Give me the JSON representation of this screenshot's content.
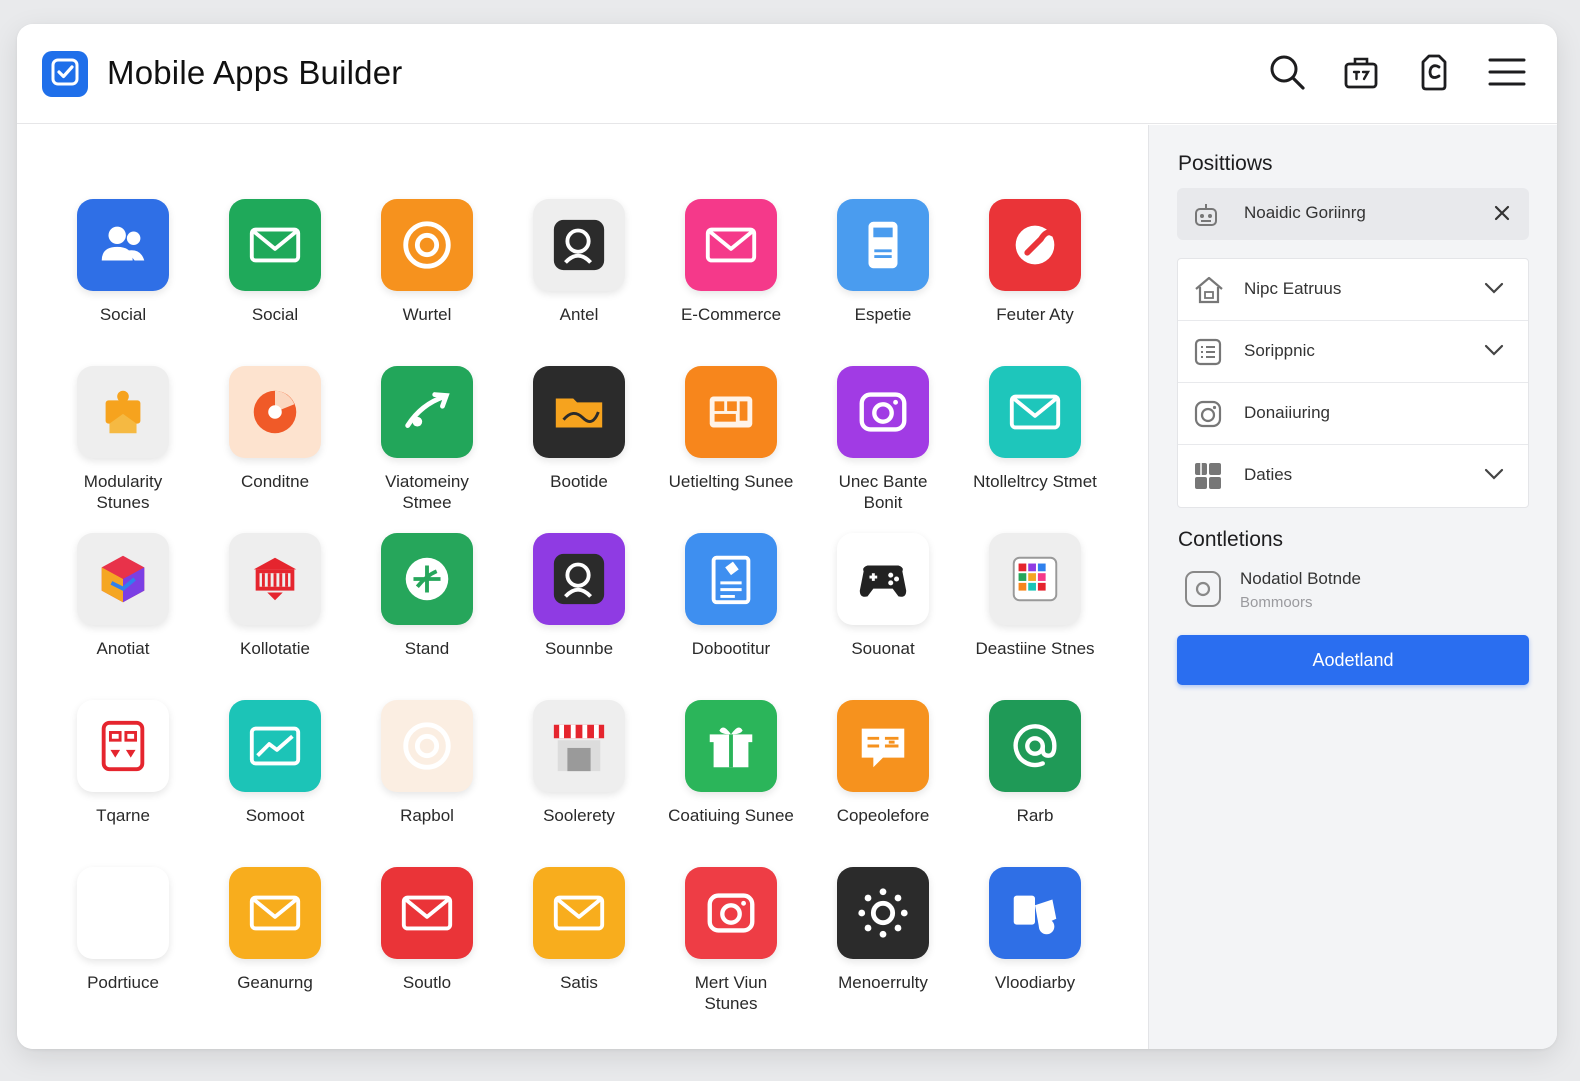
{
  "header": {
    "title": "Mobile Apps Builder",
    "logo_color": "#1f6fea",
    "actions": [
      "search-icon",
      "briefcase-icon",
      "tag-icon",
      "menu-icon"
    ]
  },
  "apps": [
    {
      "label": "Social",
      "bg": "#2f6fe6",
      "icon": "users-icon"
    },
    {
      "label": "Social",
      "bg": "#1fa95a",
      "icon": "mail-icon"
    },
    {
      "label": "Wurtel",
      "bg": "#f6921e",
      "icon": "target-icon"
    },
    {
      "label": "Antel",
      "bg": "#eeeeee",
      "icon": "search-icon"
    },
    {
      "label": "E-Commerce",
      "bg": "#f5398a",
      "icon": "mail-icon"
    },
    {
      "label": "Espetie",
      "bg": "#4a9cef",
      "icon": "phone-icon"
    },
    {
      "label": "Feuter Aty",
      "bg": "#ea3438",
      "icon": "wrench-icon"
    },
    {
      "label": "Modularity Stunes",
      "bg": "#eeeeee",
      "icon": "puzzle-icon"
    },
    {
      "label": "Conditne",
      "bg": "#fde3cf",
      "icon": "pie-icon"
    },
    {
      "label": "Viatomeiny Stmee",
      "bg": "#22a65a",
      "icon": "arrow-icon"
    },
    {
      "label": "Bootide",
      "bg": "#2b2b2b",
      "icon": "folder-icon"
    },
    {
      "label": "Uetielting Sunee",
      "bg": "#f7861c",
      "icon": "grid-icon"
    },
    {
      "label": "Unec Bante Bonit",
      "bg": "#a13be4",
      "icon": "camera-icon"
    },
    {
      "label": "Ntolleltrcy Stmet",
      "bg": "#1ec6bb",
      "icon": "mail-icon"
    },
    {
      "label": "Anotiat",
      "bg": "#eeeeee",
      "icon": "cube-icon"
    },
    {
      "label": "Kollotatie",
      "bg": "#eeeeee",
      "icon": "store-icon"
    },
    {
      "label": "Stand",
      "bg": "#26a65b",
      "icon": "leaf-icon"
    },
    {
      "label": "Sounnbe",
      "bg": "#8f3be3",
      "icon": "search-icon"
    },
    {
      "label": "Dobootitur",
      "bg": "#3e8ff0",
      "icon": "document-icon"
    },
    {
      "label": "Souonat",
      "bg": "#ffffff",
      "icon": "gamepad-icon"
    },
    {
      "label": "Deastiine Stnes",
      "bg": "#eeeeee",
      "icon": "palette-icon"
    },
    {
      "label": "Tqarne",
      "bg": "#ffffff",
      "icon": "calculator-icon"
    },
    {
      "label": "Somoot",
      "bg": "#1cc4b7",
      "icon": "chart-icon"
    },
    {
      "label": "Rapbol",
      "bg": "#fbeee2",
      "icon": "target-icon"
    },
    {
      "label": "Soolerety",
      "bg": "#eeeeee",
      "icon": "storefront-icon"
    },
    {
      "label": "Coatiuing Sunee",
      "bg": "#2bb55a",
      "icon": "gift-icon"
    },
    {
      "label": "Copeolefore",
      "bg": "#f6921e",
      "icon": "chat-icon"
    },
    {
      "label": "Rarb",
      "bg": "#1f9a57",
      "icon": "at-icon"
    },
    {
      "label": "Podrtiuce",
      "bg": "#ffffff",
      "icon": "mail-icon"
    },
    {
      "label": "Geanurng",
      "bg": "#f8ad1d",
      "icon": "mail-icon"
    },
    {
      "label": "Soutlo",
      "bg": "#ea3438",
      "icon": "mail-icon"
    },
    {
      "label": "Satis",
      "bg": "#f8ad1d",
      "icon": "mail-icon"
    },
    {
      "label": "Mert Viun Stunes",
      "bg": "#ee3d45",
      "icon": "camera-icon"
    },
    {
      "label": "Menoerrulty",
      "bg": "#2b2b2b",
      "icon": "gear-icon"
    },
    {
      "label": "Vloodiarby",
      "bg": "#2f6fe6",
      "icon": "shapes-icon"
    }
  ],
  "sidebar": {
    "positions_title": "Posittiows",
    "chip": {
      "label": "Noaidic Goriinrg",
      "icon": "robot-icon"
    },
    "list": [
      {
        "label": "Nipc Eatruus",
        "icon": "home-icon",
        "chevron": true
      },
      {
        "label": "Sorippnic",
        "icon": "list-icon",
        "chevron": true
      },
      {
        "label": "Donaiiuring",
        "icon": "camera-icon",
        "chevron": false
      },
      {
        "label": "Daties",
        "icon": "grid-icon",
        "chevron": true
      }
    ],
    "connections_title": "Contletions",
    "connection": {
      "title": "Nodatiol Botnde",
      "subtitle": "Bommoors",
      "icon": "instagram-icon"
    },
    "button_label": "Aodetland"
  }
}
